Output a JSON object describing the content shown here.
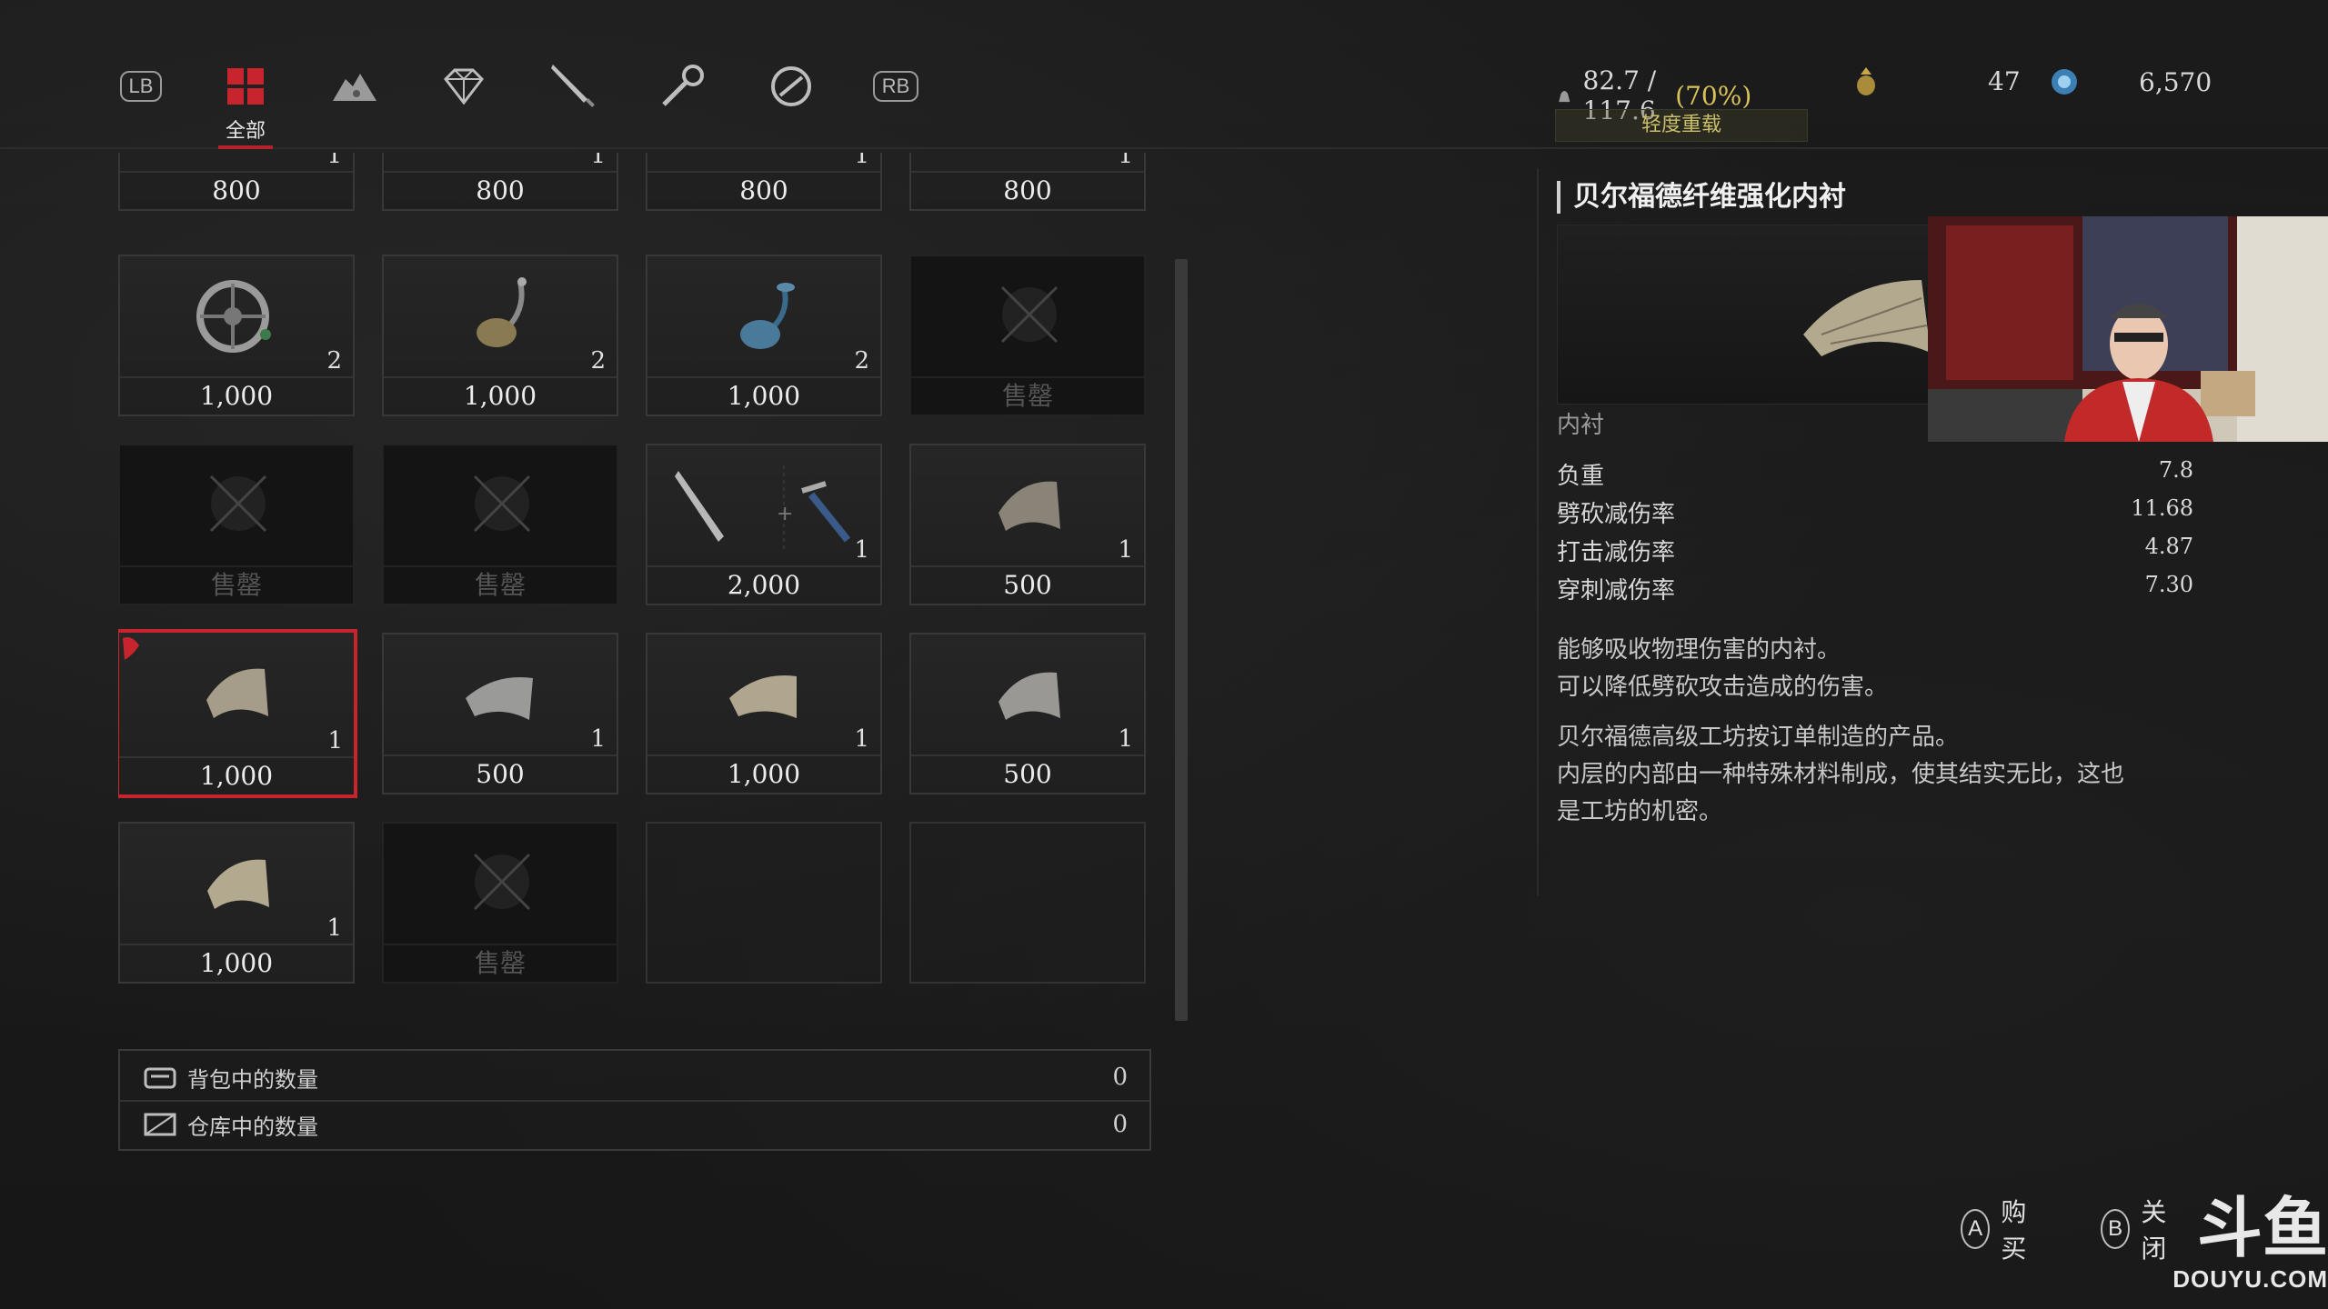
{
  "tabs": {
    "lb": "LB",
    "rb": "RB",
    "active_label": "全部",
    "items": [
      {
        "icon": "lb-bumper"
      },
      {
        "icon": "all-grid-icon",
        "label": "全部"
      },
      {
        "icon": "material-pile-icon"
      },
      {
        "icon": "gem-icon"
      },
      {
        "icon": "weapon-blade-icon"
      },
      {
        "icon": "tool-icon"
      },
      {
        "icon": "amulet-icon"
      },
      {
        "icon": "rb-bumper"
      }
    ]
  },
  "stats": {
    "weight": "82.7 / 117.6",
    "weight_pct": "(70%)",
    "weight_status": "轻度重载",
    "currency1": "47",
    "currency2": "6,570"
  },
  "grid": {
    "row0": [
      {
        "qty": "1",
        "price": "800"
      },
      {
        "qty": "1",
        "price": "800"
      },
      {
        "qty": "1",
        "price": "800"
      },
      {
        "qty": "1",
        "price": "800"
      }
    ],
    "row1": [
      {
        "qty": "2",
        "price": "1,000"
      },
      {
        "qty": "2",
        "price": "1,000"
      },
      {
        "qty": "2",
        "price": "1,000"
      },
      {
        "qty": "",
        "price": "售罄"
      }
    ],
    "row2": [
      {
        "qty": "",
        "price": "售罄"
      },
      {
        "qty": "",
        "price": "售罄"
      },
      {
        "qty": "1",
        "price": "2,000"
      },
      {
        "qty": "1",
        "price": "500"
      }
    ],
    "row3": [
      {
        "qty": "1",
        "price": "1,000"
      },
      {
        "qty": "1",
        "price": "500"
      },
      {
        "qty": "1",
        "price": "1,000"
      },
      {
        "qty": "1",
        "price": "500"
      }
    ],
    "row4": [
      {
        "qty": "1",
        "price": "1,000"
      },
      {
        "qty": "",
        "price": "售罄"
      }
    ]
  },
  "counts": {
    "backpack_label": "背包中的数量",
    "backpack_value": "0",
    "storage_label": "仓库中的数量",
    "storage_value": "0"
  },
  "detail": {
    "title": "贝尔福德纤维强化内衬",
    "category": "内衬",
    "attributes": [
      {
        "name": "负重",
        "value": "7.8"
      },
      {
        "name": "劈砍减伤率",
        "value": "11.68"
      },
      {
        "name": "打击减伤率",
        "value": "4.87"
      },
      {
        "name": "穿刺减伤率",
        "value": "7.30"
      }
    ],
    "desc1": "能够吸收物理伤害的内衬。",
    "desc2": "可以降低劈砍攻击造成的伤害。",
    "desc3": "贝尔福德高级工坊按订单制造的产品。",
    "desc4": "内层的内部由一种特殊材料制成，使其结实无比，这也",
    "desc5": "是工坊的机密。"
  },
  "prompts": {
    "a_key": "A",
    "a_label": "购买",
    "b_key": "B",
    "b_label": "关闭"
  },
  "watermark": {
    "logo": "斗鱼",
    "text": "DOUYU.COM"
  },
  "colors": {
    "accent": "#c8242e",
    "weight_pct": "#d8c25a",
    "status_text": "#c9bf6a"
  }
}
